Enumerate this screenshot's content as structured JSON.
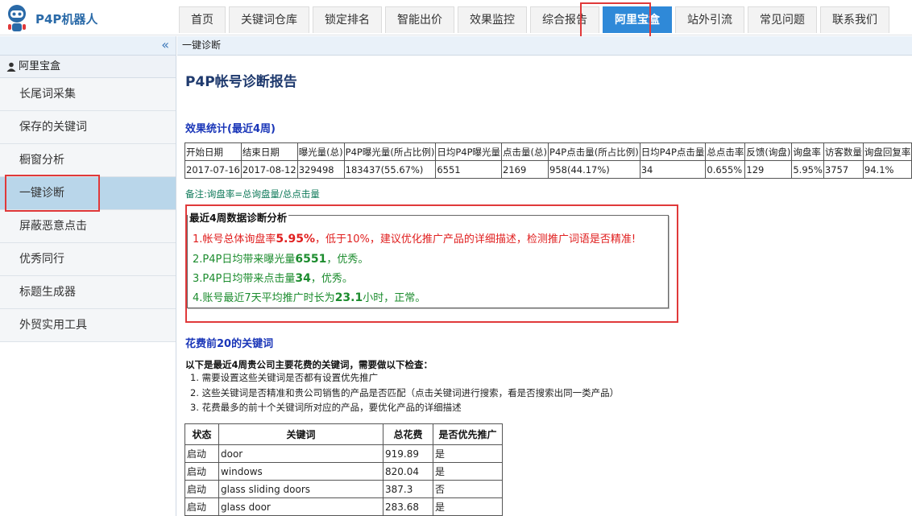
{
  "brand": {
    "name": "P4P机器人"
  },
  "nav": {
    "items": [
      {
        "label": "首页"
      },
      {
        "label": "关键词仓库"
      },
      {
        "label": "锁定排名"
      },
      {
        "label": "智能出价"
      },
      {
        "label": "效果监控"
      },
      {
        "label": "综合报告"
      },
      {
        "label": "阿里宝盒"
      },
      {
        "label": "站外引流"
      },
      {
        "label": "常见问题"
      },
      {
        "label": "联系我们"
      }
    ],
    "active_index": 6
  },
  "sidebar": {
    "collapse_glyph": "«",
    "group_label": "阿里宝盒",
    "items": [
      {
        "label": "长尾词采集"
      },
      {
        "label": "保存的关键词"
      },
      {
        "label": "橱窗分析"
      },
      {
        "label": "一键诊断"
      },
      {
        "label": "屏蔽恶意点击"
      },
      {
        "label": "优秀同行"
      },
      {
        "label": "标题生成器"
      },
      {
        "label": "外贸实用工具"
      }
    ],
    "active_index": 3
  },
  "breadcrumb": "一键诊断",
  "report": {
    "title": "P4P帐号诊断报告",
    "stats_title": "效果统计(最近4周)",
    "stats_headers": [
      "开始日期",
      "结束日期",
      "曝光量(总)",
      "P4P曝光量(所占比例)",
      "日均P4P曝光量",
      "点击量(总)",
      "P4P点击量(所占比例)",
      "日均P4P点击量",
      "总点击率",
      "反馈(询盘)",
      "询盘率",
      "访客数量",
      "询盘回复率"
    ],
    "stats_values": [
      "2017-07-16",
      "2017-08-12",
      "329498",
      "183437(55.67%)",
      "6551",
      "2169",
      "958(44.17%)",
      "34",
      "0.655%",
      "129",
      "5.95%",
      "3757",
      "94.1%"
    ],
    "note": "备注:询盘率=总询盘量/总点击量",
    "diagnosis": {
      "legend": "最近4周数据诊断分析",
      "line1": {
        "prefix": "1.帐号总体询盘率",
        "value": "5.95%",
        "suffix": "，低于10%，建议优化推广产品的详细描述，检测推广词语是否精准!"
      },
      "line2": {
        "prefix": "2.P4P日均带来曝光量",
        "value": "6551",
        "suffix": "，优秀。"
      },
      "line3": {
        "prefix": "3.P4P日均带来点击量",
        "value": "34",
        "suffix": "，优秀。"
      },
      "line4": {
        "prefix": "4.账号最近7天平均推广时长为",
        "value": "23.1",
        "suffix": "小时，正常。"
      }
    },
    "spend_title": "花费前20的关键词",
    "check_intro": "以下是最近4周贵公司主要花费的关键词，需要做以下检查：",
    "checks": [
      "1. 需要设置这些关键词是否都有设置优先推广",
      "2. 这些关键词是否精准和贵公司销售的产品是否匹配（点击关键词进行搜索，看是否搜索出同一类产品）",
      "3. 花费最多的前十个关键词所对应的产品，要优化产品的详细描述"
    ],
    "kw_headers": [
      "状态",
      "关键词",
      "总花费",
      "是否优先推广"
    ],
    "kw_rows": [
      {
        "status": "启动",
        "keyword": "door",
        "cost": "919.89",
        "priority": "是"
      },
      {
        "status": "启动",
        "keyword": "windows",
        "cost": "820.04",
        "priority": "是"
      },
      {
        "status": "启动",
        "keyword": "glass sliding doors",
        "cost": "387.3",
        "priority": "否"
      },
      {
        "status": "启动",
        "keyword": "glass door",
        "cost": "283.68",
        "priority": "是"
      }
    ]
  },
  "colors": {
    "accent": "#2f89d8",
    "highlight": "#e0393a",
    "good": "#1c8c2e",
    "bad": "#e02020"
  }
}
